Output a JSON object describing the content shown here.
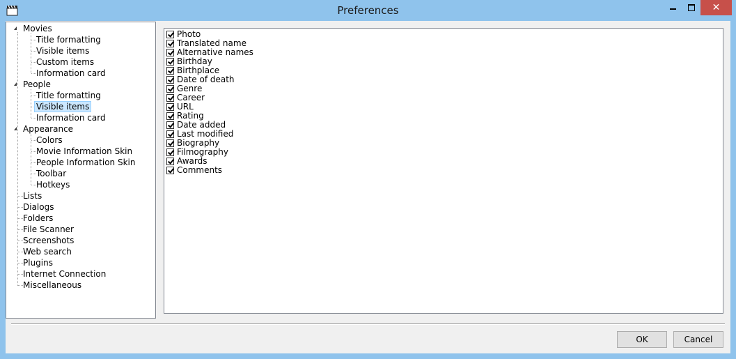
{
  "window": {
    "title": "Preferences",
    "icon": "clapperboard-icon",
    "controls": {
      "minimize": "minimize-icon",
      "maximize": "maximize-icon",
      "close": "✕"
    }
  },
  "tree": {
    "movies": {
      "label": "Movies",
      "children": [
        "Title formatting",
        "Visible items",
        "Custom items",
        "Information card"
      ]
    },
    "people": {
      "label": "People",
      "children": [
        "Title formatting",
        "Visible items",
        "Information card"
      ],
      "selected": "Visible items"
    },
    "appearance": {
      "label": "Appearance",
      "children": [
        "Colors",
        "Movie Information Skin",
        "People Information Skin",
        "Toolbar",
        "Hotkeys"
      ]
    },
    "top_items": [
      "Lists",
      "Dialogs",
      "Folders",
      "File Scanner",
      "Screenshots",
      "Web search",
      "Plugins",
      "Internet Connection",
      "Miscellaneous"
    ]
  },
  "visible_items": [
    {
      "label": "Photo",
      "checked": true
    },
    {
      "label": "Translated name",
      "checked": true
    },
    {
      "label": "Alternative names",
      "checked": true
    },
    {
      "label": "Birthday",
      "checked": true
    },
    {
      "label": "Birthplace",
      "checked": true
    },
    {
      "label": "Date of death",
      "checked": true
    },
    {
      "label": "Genre",
      "checked": true
    },
    {
      "label": "Career",
      "checked": true
    },
    {
      "label": "URL",
      "checked": true
    },
    {
      "label": "Rating",
      "checked": true
    },
    {
      "label": "Date added",
      "checked": true
    },
    {
      "label": "Last modified",
      "checked": true
    },
    {
      "label": "Biography",
      "checked": true
    },
    {
      "label": "Filmography",
      "checked": true
    },
    {
      "label": "Awards",
      "checked": true
    },
    {
      "label": "Comments",
      "checked": true
    }
  ],
  "buttons": {
    "ok": "OK",
    "cancel": "Cancel"
  },
  "colors": {
    "titlebar": "#8fc3ec",
    "close": "#c7504a",
    "selection": "#cce8ff"
  }
}
